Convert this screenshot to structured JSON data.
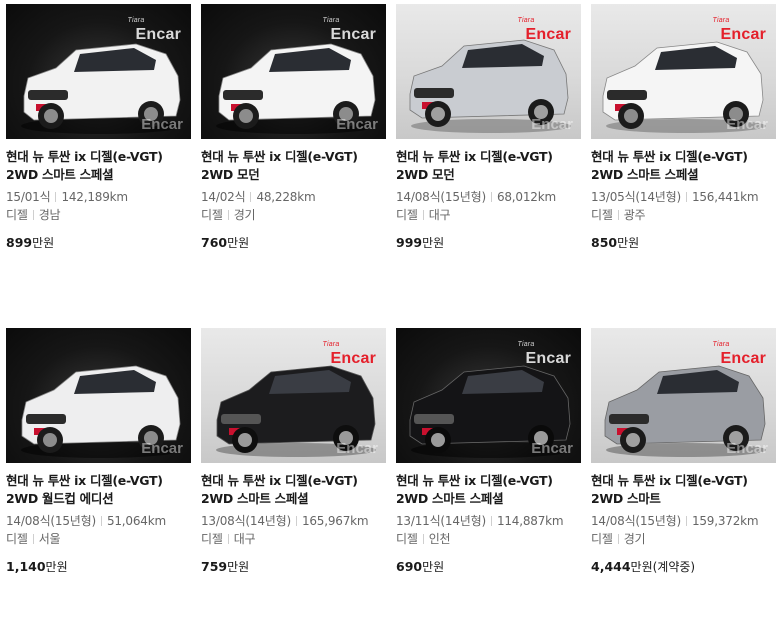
{
  "listings": [
    {
      "title": "현대 뉴 투싼 ix 디젤(e-VGT) 2WD 스마트 스페셜",
      "year": "15/01식",
      "mileage": "142,189km",
      "fuel": "디젤",
      "region": "경남",
      "price": "899",
      "price_unit": "만원",
      "car_color": "#f2f2f2",
      "bg": "dark",
      "logo": "Encar",
      "watermark": "Encar"
    },
    {
      "title": "현대 뉴 투싼 ix 디젤(e-VGT) 2WD 모던",
      "year": "14/02식",
      "mileage": "48,228km",
      "fuel": "디젤",
      "region": "경기",
      "price": "760",
      "price_unit": "만원",
      "car_color": "#f4f4f4",
      "bg": "dark",
      "logo": "Encar",
      "watermark": "Encar"
    },
    {
      "title": "현대 뉴 투싼 ix 디젤(e-VGT) 2WD 모던",
      "year": "14/08식(15년형)",
      "mileage": "68,012km",
      "fuel": "디젤",
      "region": "대구",
      "price": "999",
      "price_unit": "만원",
      "car_color": "#c9ccd1",
      "bg": "light",
      "logo": "Encar",
      "watermark": "Encar"
    },
    {
      "title": "현대 뉴 투싼 ix 디젤(e-VGT) 2WD 스마트 스페셜",
      "year": "13/05식(14년형)",
      "mileage": "156,441km",
      "fuel": "디젤",
      "region": "광주",
      "price": "850",
      "price_unit": "만원",
      "car_color": "#f5f5f5",
      "bg": "light",
      "logo": "Encar",
      "watermark": "Encar"
    },
    {
      "title": "현대 뉴 투싼 ix 디젤(e-VGT) 2WD 월드컵 에디션",
      "year": "14/08식(15년형)",
      "mileage": "51,064km",
      "fuel": "디젤",
      "region": "서울",
      "price": "1,140",
      "price_unit": "만원",
      "car_color": "#eeeeef",
      "bg": "dark",
      "logo": "",
      "watermark": "Encar"
    },
    {
      "title": "현대 뉴 투싼 ix 디젤(e-VGT) 2WD 스마트 스페셜",
      "year": "13/08식(14년형)",
      "mileage": "165,967km",
      "fuel": "디젤",
      "region": "대구",
      "price": "759",
      "price_unit": "만원",
      "car_color": "#1c1c1e",
      "bg": "light",
      "logo": "Encar",
      "watermark": "Encar"
    },
    {
      "title": "현대 뉴 투싼 ix 디젤(e-VGT) 2WD 스마트 스페셜",
      "year": "13/11식(14년형)",
      "mileage": "114,887km",
      "fuel": "디젤",
      "region": "인천",
      "price": "690",
      "price_unit": "만원",
      "car_color": "#141416",
      "bg": "dark",
      "logo": "Encar",
      "watermark": "Encar"
    },
    {
      "title": "현대 뉴 투싼 ix 디젤(e-VGT) 2WD 스마트",
      "year": "14/08식(15년형)",
      "mileage": "159,372km",
      "fuel": "디젤",
      "region": "경기",
      "price": "4,444",
      "price_unit": "만원(계약중)",
      "car_color": "#9a9da3",
      "bg": "light",
      "logo": "Encar",
      "watermark": "Encar"
    }
  ]
}
